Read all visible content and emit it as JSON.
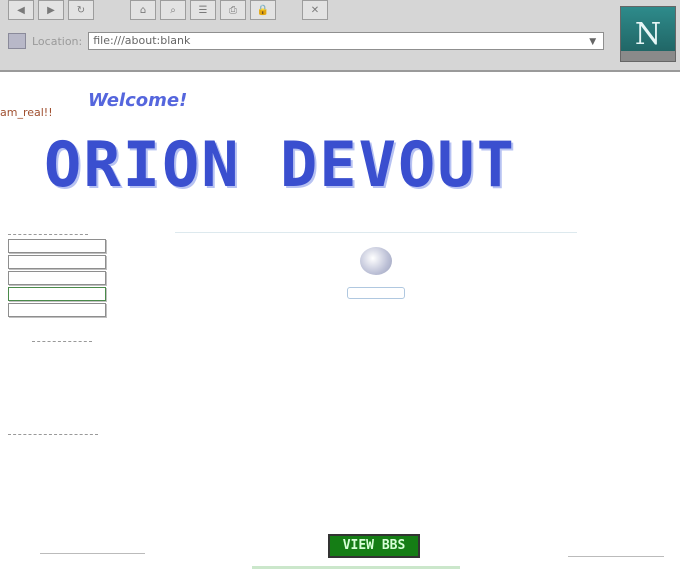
{
  "browser": {
    "location_label": "Location:",
    "url": "file:///about:blank",
    "logo_letter": "N"
  },
  "page": {
    "welcome": "Welcome!",
    "tag": "am_real!!",
    "title": "ORION DEVOUT",
    "view_button": "VIEW BBS"
  }
}
